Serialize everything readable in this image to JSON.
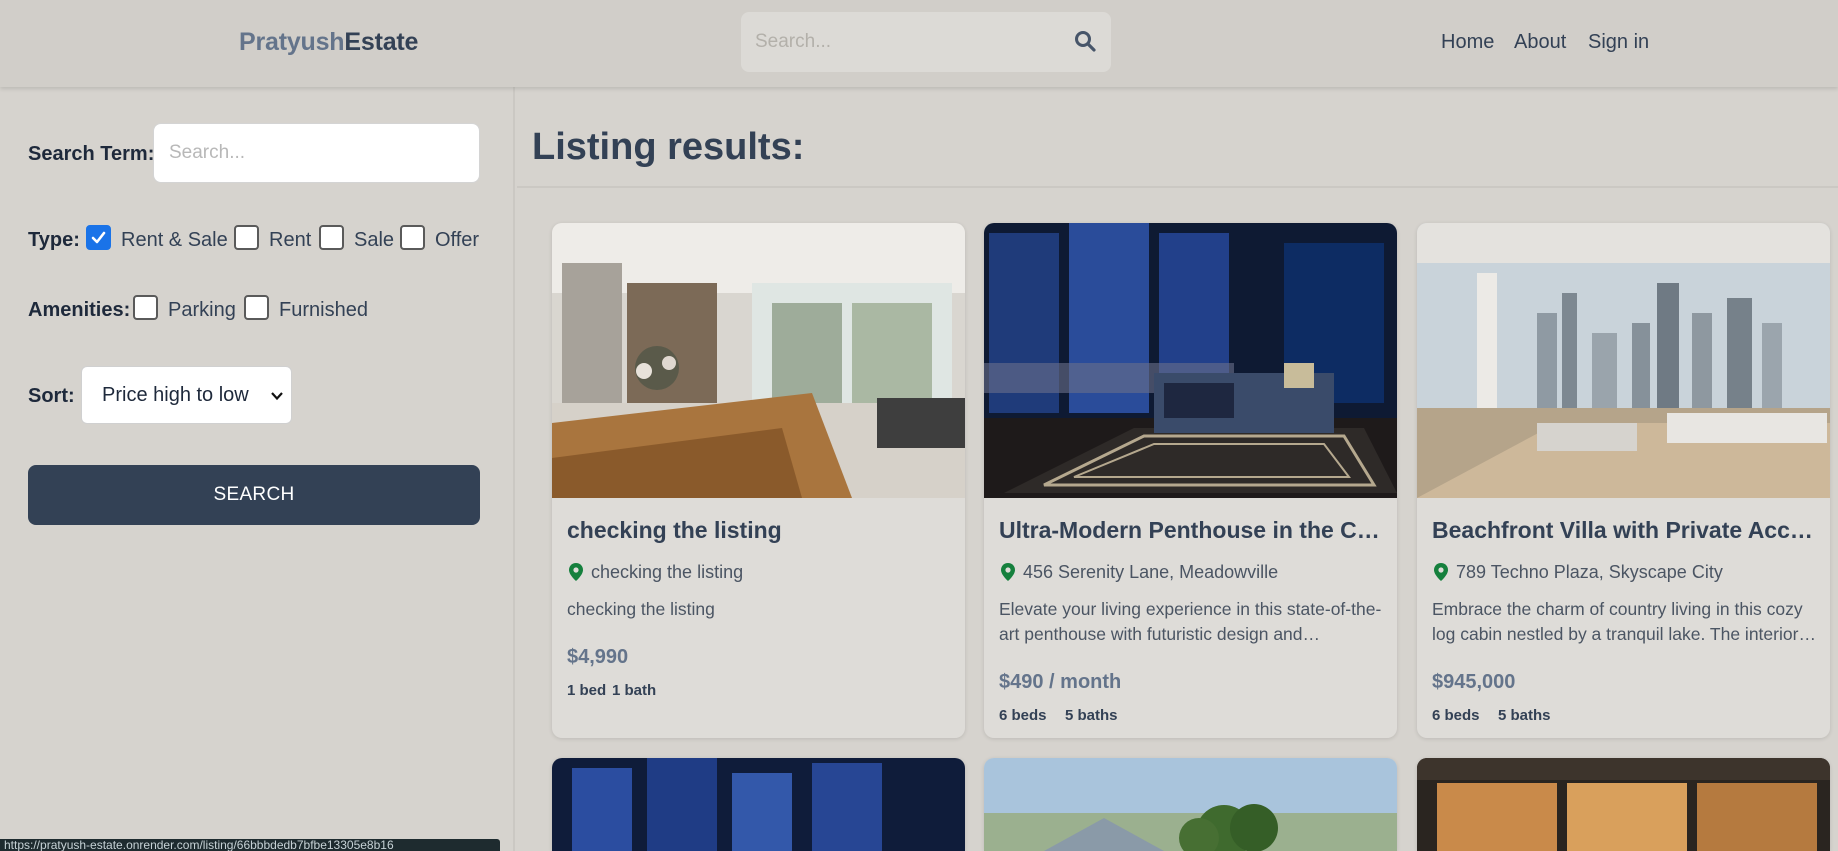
{
  "header": {
    "logo_part1": "Pratyush",
    "logo_part2": "Estate",
    "search_placeholder": "Search...",
    "nav": {
      "home": "Home",
      "about": "About",
      "signin": "Sign in"
    }
  },
  "sidebar": {
    "search_term_label": "Search Term:",
    "search_term_placeholder": "Search...",
    "type_label": "Type:",
    "type_options": [
      {
        "label": "Rent & Sale",
        "checked": true
      },
      {
        "label": "Rent",
        "checked": false
      },
      {
        "label": "Sale",
        "checked": false
      },
      {
        "label": "Offer",
        "checked": false
      }
    ],
    "amenities_label": "Amenities:",
    "amenities_options": [
      {
        "label": "Parking",
        "checked": false
      },
      {
        "label": "Furnished",
        "checked": false
      }
    ],
    "sort_label": "Sort:",
    "sort_value": "Price high to low",
    "search_button": "SEARCH"
  },
  "main": {
    "results_title": "Listing results:",
    "listings": [
      {
        "title": "checking the listing",
        "address": "checking the listing",
        "description": "checking the listing",
        "price": "$4,990",
        "beds": "1 bed",
        "baths": "1 bath"
      },
      {
        "title": "Ultra-Modern Penthouse in the Clouds",
        "address": "456 Serenity Lane, Meadowville",
        "description": "Elevate your living experience in this state-of-the-art penthouse with futuristic design and breathtaking views",
        "price": "$490 / month",
        "beds": "6 beds",
        "baths": "5 baths"
      },
      {
        "title": "Beachfront Villa with Private Access",
        "address": "789 Techno Plaza, Skyscape City",
        "description": "Embrace the charm of country living in this cozy log cabin nestled by a tranquil lake. The interior features",
        "price": "$945,000",
        "beds": "6 beds",
        "baths": "5 baths"
      }
    ]
  },
  "status_bar": "https://pratyush-estate.onrender.com/listing/66bbbdedb7bfbe13305e8b16",
  "colors": {
    "page_bg": "#d6d3ce",
    "header_bg": "#d1cec9",
    "primary": "#334155",
    "logo_light": "#64748b",
    "pin_green": "#15803d",
    "checkbox_blue": "#1a73e8"
  }
}
